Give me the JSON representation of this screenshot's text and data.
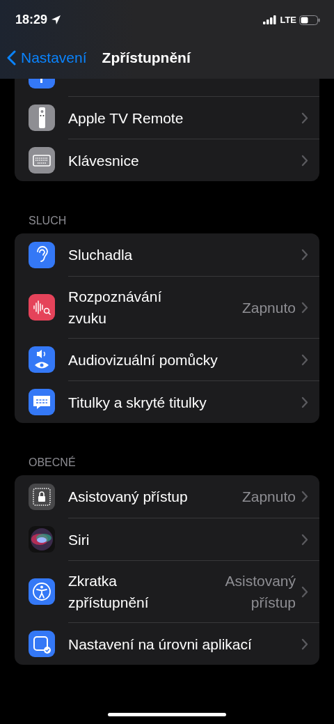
{
  "status_bar": {
    "time": "18:29",
    "network": "LTE"
  },
  "nav": {
    "back": "Nastavení",
    "title": "Zpřístupnění"
  },
  "groups": [
    {
      "items": [
        {
          "kind": "side-button",
          "partial": true
        },
        {
          "kind": "remote",
          "label": "Apple TV Remote"
        },
        {
          "kind": "keyboard",
          "label": "Klávesnice"
        }
      ]
    },
    {
      "header": "SLUCH",
      "items": [
        {
          "kind": "ear",
          "label": "Sluchadla"
        },
        {
          "kind": "sound",
          "label": "Rozpoznávání\nzvuku",
          "value": "Zapnuto"
        },
        {
          "kind": "av",
          "label": "Audiovizuální pomůcky"
        },
        {
          "kind": "captions",
          "label": "Titulky a skryté titulky"
        }
      ]
    },
    {
      "header": "OBECNÉ",
      "items": [
        {
          "kind": "lock",
          "label": "Asistovaný přístup",
          "value": "Zapnuto"
        },
        {
          "kind": "siri",
          "label": "Siri"
        },
        {
          "kind": "access",
          "label": "Zkratka\nzpřístupnění",
          "value": "Asistovaný\npřístup"
        },
        {
          "kind": "app",
          "label": "Nastavení na úrovni aplikací"
        }
      ]
    }
  ]
}
